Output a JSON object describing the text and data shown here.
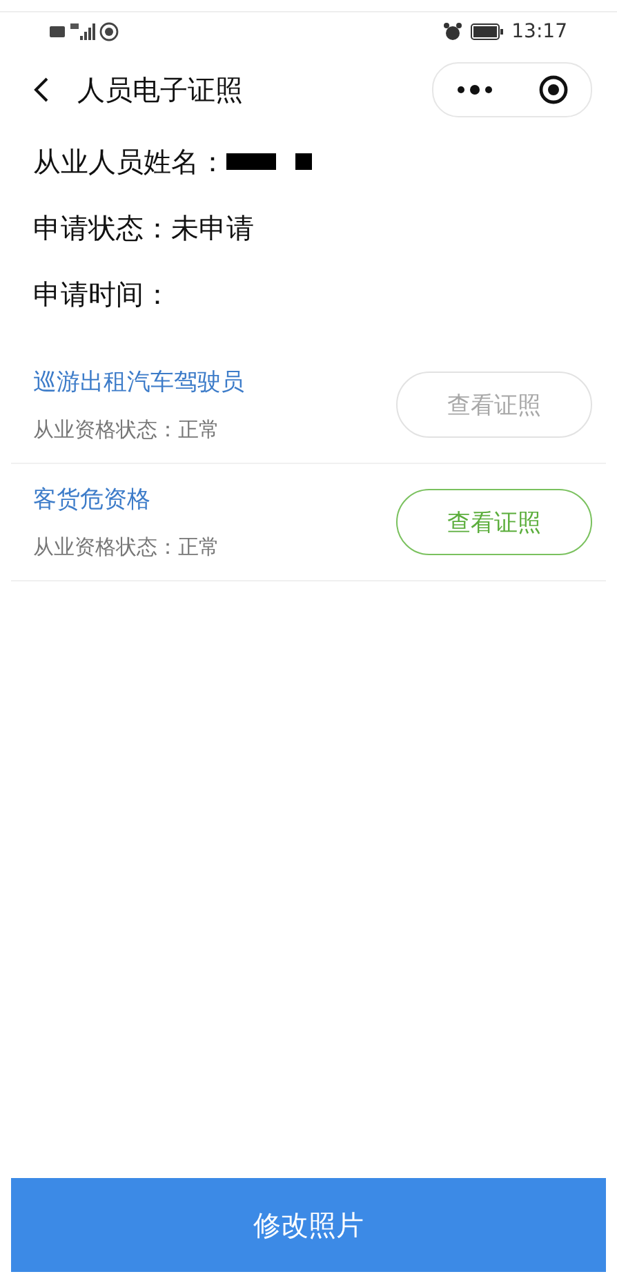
{
  "status_bar": {
    "time": "13:17"
  },
  "nav": {
    "title": "人员电子证照"
  },
  "fields": [
    {
      "label": "从业人员姓名：",
      "redacted": true
    },
    {
      "label": "申请状态：",
      "value": "未申请"
    },
    {
      "label": "申请时间："
    }
  ],
  "qualifications": [
    {
      "title": "巡游出租汽车驾驶员",
      "status": "从业资格状态：正常",
      "button": "查看证照",
      "disabled": true
    },
    {
      "title": "客货危资格",
      "status": "从业资格状态：正常",
      "button": "查看证照",
      "disabled": false
    }
  ],
  "footer_button": "修改照片"
}
